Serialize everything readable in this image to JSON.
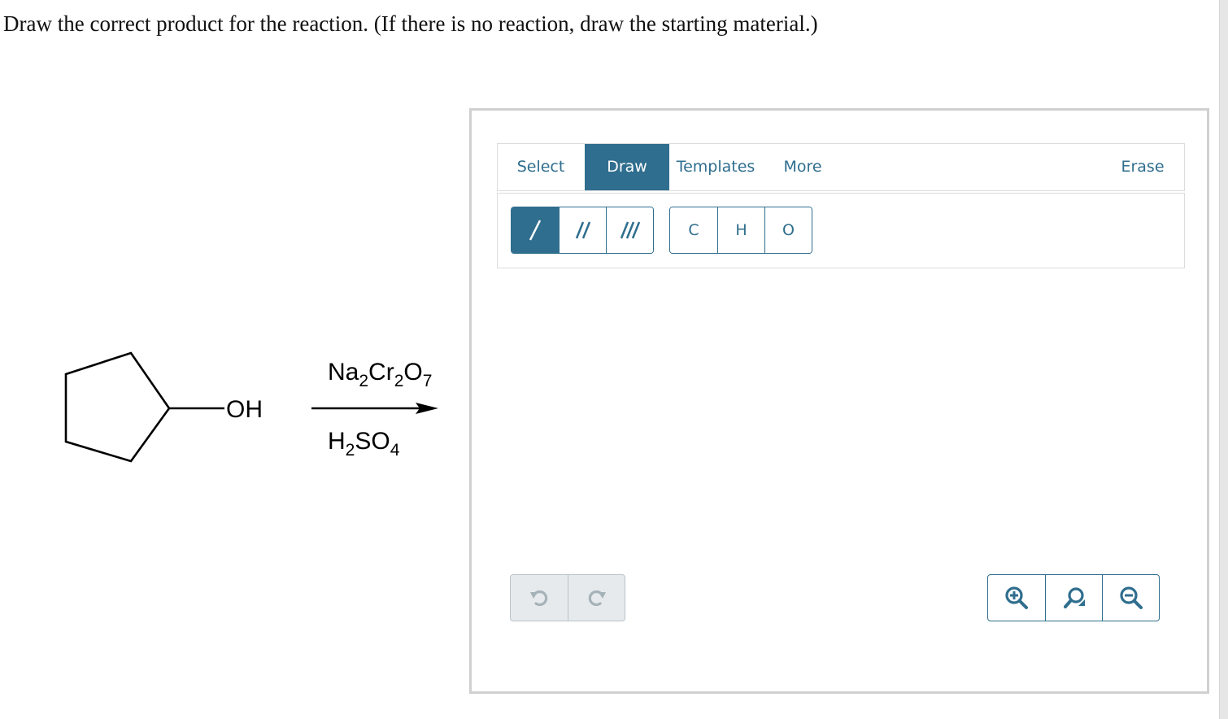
{
  "question": {
    "text": "Draw the correct product for the reaction. (If there is no reaction, draw the starting material.)"
  },
  "reaction": {
    "substituent": "OH",
    "reagent_top": {
      "parts": [
        "Na",
        "2",
        "Cr",
        "2",
        "O",
        "7"
      ]
    },
    "reagent_bottom": {
      "parts": [
        "H",
        "2",
        "SO",
        "4"
      ]
    }
  },
  "editor": {
    "menu": {
      "select": "Select",
      "draw": "Draw",
      "templates": "Templates",
      "more": "More",
      "erase": "Erase"
    },
    "active_menu": "Draw",
    "bond_tools": [
      "single-bond-icon",
      "double-bond-icon",
      "triple-bond-icon"
    ],
    "atoms": [
      "C",
      "H",
      "O"
    ],
    "history_controls": [
      "undo-icon",
      "redo-icon"
    ],
    "zoom_controls": [
      "zoom-in-icon",
      "zoom-reset-icon",
      "zoom-out-icon"
    ]
  },
  "colors": {
    "accent": "#2f6e8e",
    "border": "#dcdcdc",
    "disabled_bg": "#e6eaec"
  }
}
